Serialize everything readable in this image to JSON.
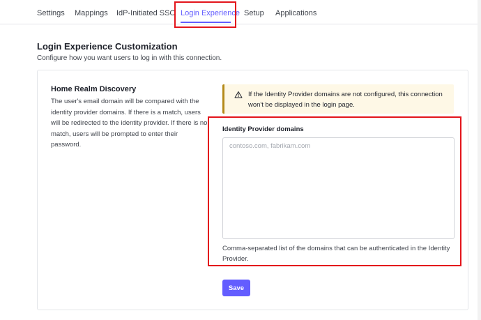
{
  "tabs": [
    {
      "label": "Settings"
    },
    {
      "label": "Mappings"
    },
    {
      "label": "IdP-Initiated SSO"
    },
    {
      "label": "Login Experience",
      "active": true
    },
    {
      "label": "Setup"
    },
    {
      "label": "Applications"
    }
  ],
  "section": {
    "title": "Login Experience Customization",
    "subtitle": "Configure how you want users to log in with this connection."
  },
  "home_realm": {
    "title": "Home Realm Discovery",
    "description": "The user's email domain will be compared with the identity provider domains. If there is a match, users will be redirected to the identity provider. If there is no match, users will be prompted to enter their password."
  },
  "warning": {
    "icon": "warning-triangle-icon",
    "text": "If the Identity Provider domains are not configured, this connection won't be displayed in the login page."
  },
  "domains_field": {
    "label": "Identity Provider domains",
    "value": "",
    "placeholder": "contoso.com, fabrikam.com",
    "help": "Comma-separated list of the domains that can be authenticated in the Identity Provider."
  },
  "actions": {
    "save_label": "Save"
  },
  "colors": {
    "accent": "#635dff",
    "highlight": "#e3141b",
    "warning_bg": "#fef8e6",
    "warning_border": "#b48a19"
  }
}
